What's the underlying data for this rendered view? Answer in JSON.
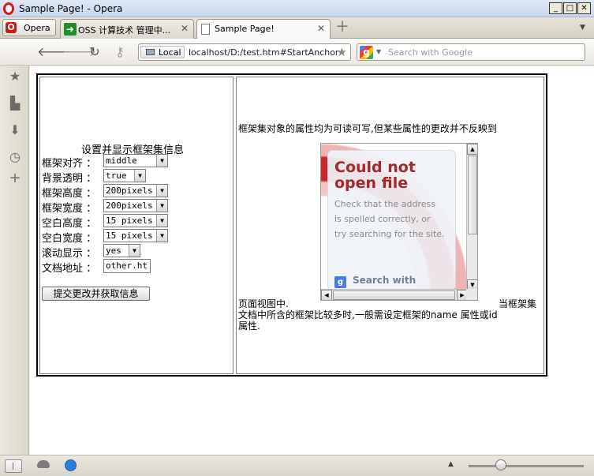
{
  "window": {
    "title": "Sample Page! - Opera"
  },
  "tabs": {
    "menu_label": "Opera",
    "items": [
      {
        "label": "OSS 计算技术 管理中...",
        "active": false
      },
      {
        "label": "Sample Page!",
        "active": true
      }
    ]
  },
  "addressbar": {
    "security_label": "Local",
    "url": "localhost/D:/test.htm#StartAnchor",
    "search_placeholder": "Search with Google"
  },
  "form": {
    "title": "设置并显示框架集信息",
    "fields": [
      {
        "label": "框架对齐 ：",
        "value": "middle"
      },
      {
        "label": "背景透明 ：",
        "value": "true"
      },
      {
        "label": "框架高度 ：",
        "value": "200pixels"
      },
      {
        "label": "框架宽度 ：",
        "value": "200pixels"
      },
      {
        "label": "空白高度 ：",
        "value": "15 pixels"
      },
      {
        "label": "空白宽度 ：",
        "value": "15 pixels"
      },
      {
        "label": "滚动显示 ：",
        "value": "yes"
      },
      {
        "label": "文档地址 ：",
        "value": "other.ht"
      }
    ],
    "submit_label": "提交更改并获取信息"
  },
  "content": {
    "line1": "框架集对象的属性均为可读可写,但某些属性的更改并不反映到",
    "line2_left": "页面视图中.",
    "line2_right": "当框架集",
    "line3": "文档中所含的框架比较多时,一般需设定框架的name 属性或id",
    "line4": "属性."
  },
  "iframe_error": {
    "heading": "Could not open file",
    "message": "Check that the address is spelled correctly, or try searching for the site.",
    "search_label": "Search with"
  }
}
